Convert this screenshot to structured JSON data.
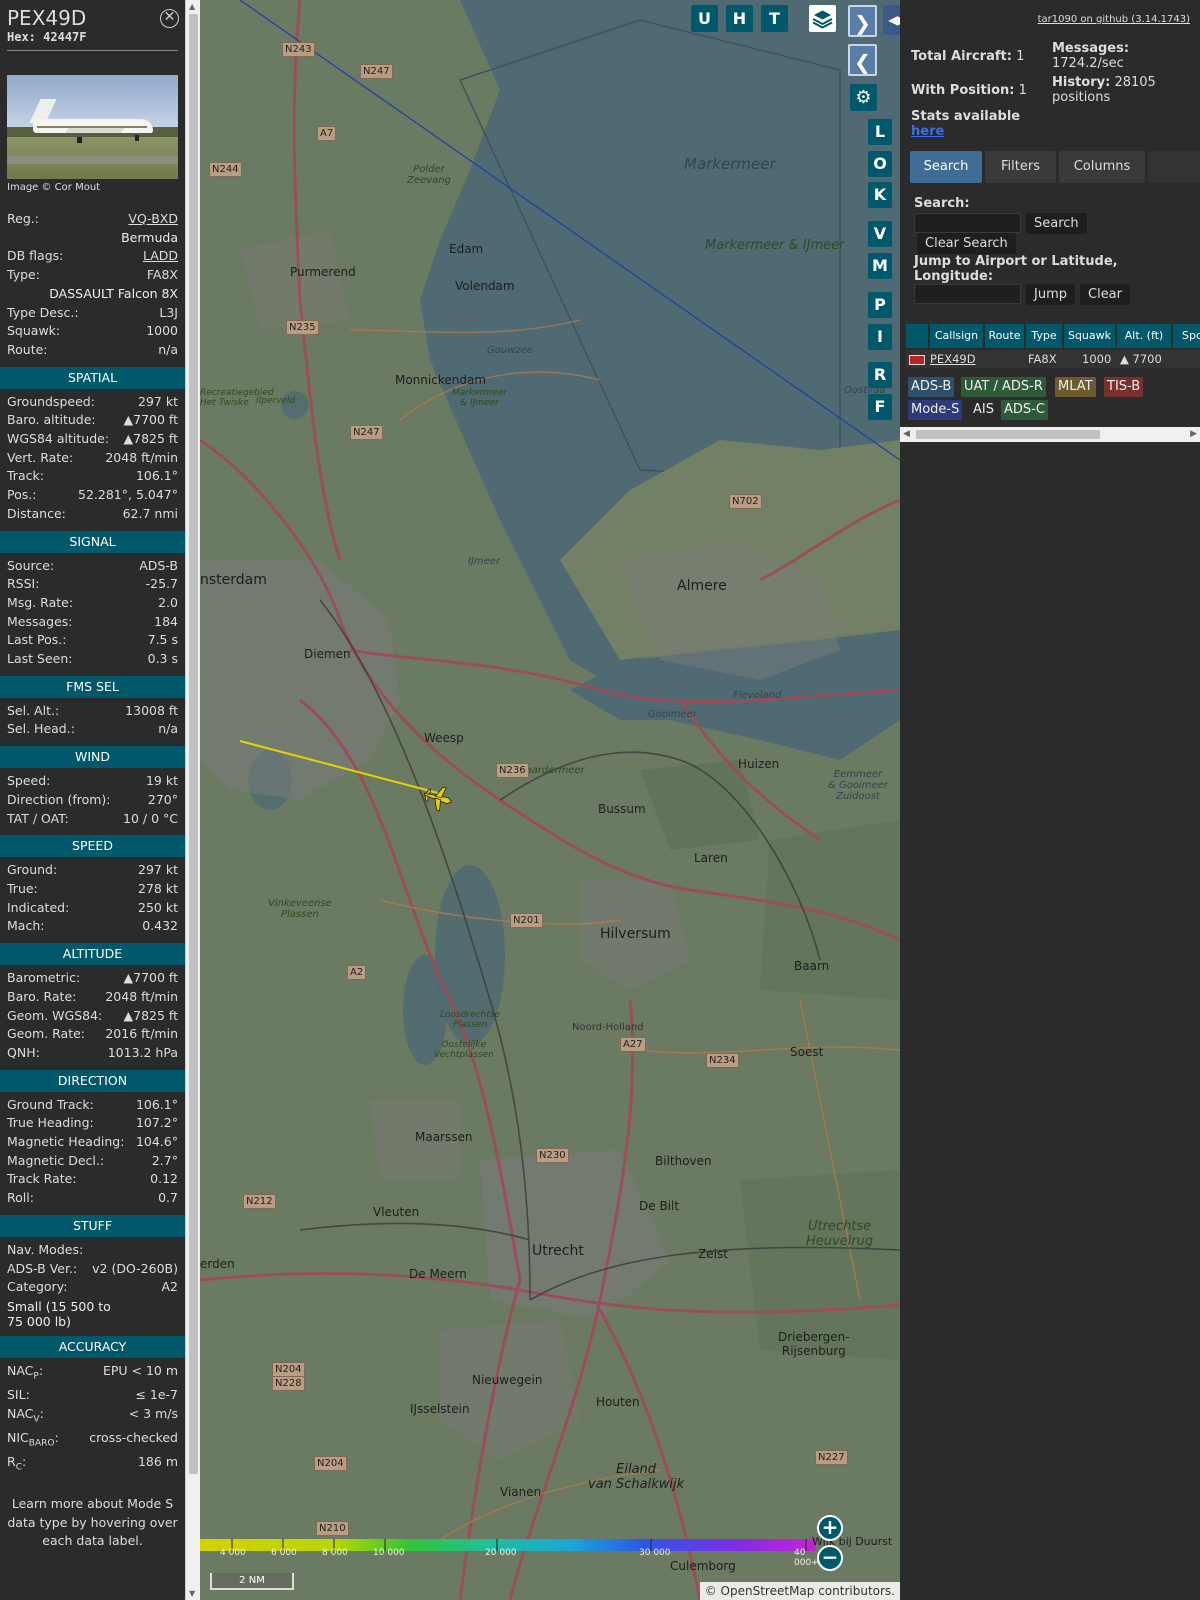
{
  "info": {
    "callsign": "PEX49D",
    "hex_label": "Hex:",
    "hex": "42447F",
    "photo_credit": "Image © Cor Mout",
    "fields": [
      {
        "k": "Reg.:",
        "v": "VQ-BXD",
        "link": true
      },
      {
        "k": "",
        "v": "Bermuda"
      },
      {
        "k": "DB flags:",
        "v": "LADD",
        "link": true
      },
      {
        "k": "Type:",
        "v": "FA8X"
      },
      {
        "k": "",
        "v": "DASSAULT Falcon 8X"
      },
      {
        "k": "Type Desc.:",
        "v": "L3J"
      },
      {
        "k": "Squawk:",
        "v": "1000"
      },
      {
        "k": "Route:",
        "v": "n/a"
      }
    ],
    "sections": [
      {
        "title": "SPATIAL",
        "rows": [
          {
            "k": "Groundspeed:",
            "v": "297 kt"
          },
          {
            "k": "Baro. altitude:",
            "v": "▲7700 ft"
          },
          {
            "k": "WGS84 altitude:",
            "v": "▲7825 ft"
          },
          {
            "k": "Vert. Rate:",
            "v": "2048 ft/min"
          },
          {
            "k": "Track:",
            "v": "106.1°"
          },
          {
            "k": "Pos.:",
            "v": "52.281°, 5.047°"
          },
          {
            "k": "Distance:",
            "v": "62.7 nmi"
          }
        ]
      },
      {
        "title": "SIGNAL",
        "rows": [
          {
            "k": "Source:",
            "v": "ADS-B"
          },
          {
            "k": "RSSI:",
            "v": "-25.7"
          },
          {
            "k": "Msg. Rate:",
            "v": "2.0"
          },
          {
            "k": "Messages:",
            "v": "184"
          },
          {
            "k": "Last Pos.:",
            "v": "7.5 s"
          },
          {
            "k": "Last Seen:",
            "v": "0.3 s"
          }
        ]
      },
      {
        "title": "FMS SEL",
        "rows": [
          {
            "k": "Sel. Alt.:",
            "v": "13008 ft"
          },
          {
            "k": "Sel. Head.:",
            "v": "n/a"
          }
        ]
      },
      {
        "title": "WIND",
        "rows": [
          {
            "k": "Speed:",
            "v": "19 kt"
          },
          {
            "k": "Direction (from):",
            "v": "270°"
          },
          {
            "k": "TAT / OAT:",
            "v": "10 / 0 °C"
          }
        ]
      },
      {
        "title": "SPEED",
        "rows": [
          {
            "k": "Ground:",
            "v": "297 kt"
          },
          {
            "k": "True:",
            "v": "278 kt"
          },
          {
            "k": "Indicated:",
            "v": "250 kt"
          },
          {
            "k": "Mach:",
            "v": "0.432"
          }
        ]
      },
      {
        "title": "ALTITUDE",
        "rows": [
          {
            "k": "Barometric:",
            "v": "▲7700 ft"
          },
          {
            "k": "Baro. Rate:",
            "v": "2048 ft/min"
          },
          {
            "k": "Geom. WGS84:",
            "v": "▲7825 ft"
          },
          {
            "k": "Geom. Rate:",
            "v": "2016 ft/min"
          },
          {
            "k": "QNH:",
            "v": "1013.2 hPa"
          }
        ]
      },
      {
        "title": "DIRECTION",
        "rows": [
          {
            "k": "Ground Track:",
            "v": "106.1°"
          },
          {
            "k": "True Heading:",
            "v": "107.2°"
          },
          {
            "k": "Magnetic Heading:",
            "v": "104.6°"
          },
          {
            "k": "Magnetic Decl.:",
            "v": "2.7°"
          },
          {
            "k": "Track Rate:",
            "v": "0.12"
          },
          {
            "k": "Roll:",
            "v": "0.7"
          }
        ]
      },
      {
        "title": "STUFF",
        "rows": [
          {
            "k": "Nav. Modes:",
            "v": ""
          },
          {
            "k": "ADS-B Ver.:",
            "v": "v2 (DO-260B)"
          },
          {
            "k": "Category:",
            "v": "A2"
          }
        ],
        "wrap": "Small (15 500 to 75 000 lb)"
      },
      {
        "title": "ACCURACY",
        "rows": [
          {
            "k": "NAC",
            "sub": "P",
            "v": "EPU < 10 m"
          },
          {
            "k": "SIL:",
            "v": "≤ 1e-7"
          },
          {
            "k": "NAC",
            "sub": "V",
            "v": "< 3 m/s"
          },
          {
            "k": "NIC",
            "sub": "BARO",
            "v": "cross-checked"
          },
          {
            "k": "R",
            "sub": "C",
            "v": "186 m"
          }
        ]
      }
    ],
    "note": "Learn more about Mode S data type by hovering over each data label."
  },
  "map": {
    "buttons_top": [
      "U",
      "H",
      "T"
    ],
    "buttons_side": [
      "L",
      "O",
      "K",
      "V",
      "M",
      "P",
      "I",
      "R",
      "F"
    ],
    "labels": {
      "markermeer": "Markermeer",
      "markermeer_ijmeer": "Markermeer & IJmeer",
      "ijmeer": "IJmeer",
      "almere": "Almere",
      "amsterdam": "nsterdam",
      "purmerend": "Purmerend",
      "edam": "Edam",
      "volendam": "Volendam",
      "monnickendam": "Monnickendam",
      "diemen": "Diemen",
      "weesp": "Weesp",
      "huizen": "Huizen",
      "bussum": "Bussum",
      "laren": "Laren",
      "hilversum": "Hilversum",
      "baarn": "Baarn",
      "soest": "Soest",
      "maarssen": "Maarssen",
      "bilthoven": "Bilthoven",
      "debilt": "De Bilt",
      "vleuten": "Vleuten",
      "utrecht": "Utrecht",
      "zeist": "Zeist",
      "demeern": "De Meern",
      "nieuwegein": "Nieuwegein",
      "houten": "Houten",
      "ijsselstein": "IJsselstein",
      "vianen": "Vianen",
      "culemborg": "Culemborg",
      "driebergen": "Driebergen-\nRijsenburg",
      "heuvelrug": "Utrechtse\nHeuvelrug",
      "eilandvs": "Eiland\nvan Schalkwijk",
      "naardermeer": "Naardermeer",
      "vinkeveense": "Vinkeveense\nPlassen",
      "gooimeer": "Gooimeer",
      "flevoland": "Flevoland",
      "eemmeer": "Eemmeer\n& Gooimeer\nZuidoost",
      "loosdrechtse": "Loosdrechtse\nPlassen",
      "oostelijke": "Oostelijke\nVechtplassen",
      "noordholland": "Noord-Holland",
      "polder": "Polder\nZeevang",
      "gouwzee": "Gouwzee",
      "ilperveld": "Ilperveld",
      "twiske": "Recreatiegebied\nHet Twiske",
      "markermeer_ijmeer_small": "Markermeer\n& IJmeer",
      "oostvaarders": "Oostvaa",
      "erden": "erden",
      "wijkduurst": "Wijk bij Duurst"
    },
    "shields": [
      "N243",
      "N247",
      "A7",
      "N244",
      "N235",
      "N247",
      "N702",
      "N236",
      "N201",
      "A2",
      "A27",
      "N234",
      "N230",
      "N212",
      "N204",
      "N228",
      "N204",
      "N210",
      "N227"
    ],
    "altitude_scale": [
      "4 000",
      "6 000",
      "8 000",
      "10 000",
      "20 000",
      "30 000",
      "40 000+"
    ],
    "distance_scale": "2 NM",
    "attribution": "© OpenStreetMap contributors."
  },
  "right": {
    "github": "tar1090 on github (3.14.1743)",
    "total_aircraft_label": "Total Aircraft:",
    "total_aircraft": "1",
    "with_position_label": "With Position:",
    "with_position": "1",
    "messages_label": "Messages:",
    "messages": "1724.2/sec",
    "history_label": "History:",
    "history": "28105 positions",
    "stats_label": "Stats available",
    "stats_link": "here",
    "tabs": [
      "Search",
      "Filters",
      "Columns"
    ],
    "search_label": "Search:",
    "search_btn": "Search",
    "clear_search_btn": "Clear Search",
    "jump_label": "Jump to Airport or Latitude, Longitude:",
    "jump_btn": "Jump",
    "clear_btn": "Clear",
    "table": {
      "headers": [
        "Callsign",
        "Route",
        "Type",
        "Squawk",
        "Alt. (ft)",
        "Spd"
      ],
      "row": {
        "callsign": "PEX49D",
        "type": "FA8X",
        "squawk": "1000",
        "alt": "▲ 7700"
      }
    },
    "legend": [
      {
        "label": "ADS-B",
        "color": "#2f5068"
      },
      {
        "label": "UAT / ADS-R",
        "color": "#2f5a3a"
      },
      {
        "label": "MLAT",
        "color": "#6d5a2f"
      },
      {
        "label": "TIS-B",
        "color": "#7a2f2f"
      },
      {
        "label": "Mode-S",
        "color": "#2f3a7a"
      },
      {
        "label": "AIS",
        "color": "#2b2b2b"
      },
      {
        "label": "ADS-C",
        "color": "#2f5a3a"
      }
    ]
  }
}
